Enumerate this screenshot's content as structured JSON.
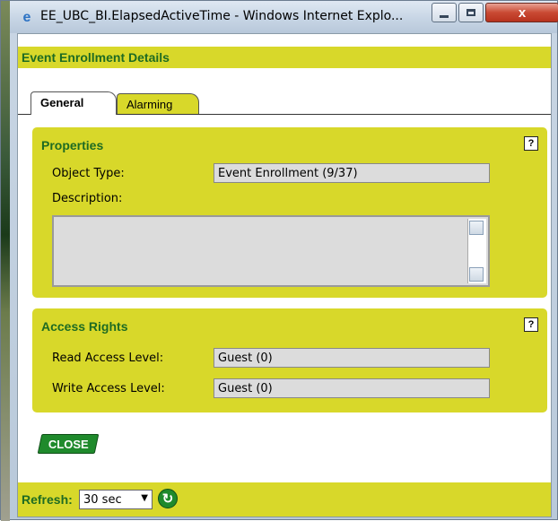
{
  "window": {
    "title": "EE_UBC_BI.ElapsedActiveTime - Windows Internet Explo...",
    "close_glyph": "x"
  },
  "header": {
    "title": "Event Enrollment Details"
  },
  "tabs": [
    {
      "label": "General",
      "active": true
    },
    {
      "label": "Alarming",
      "active": false
    }
  ],
  "properties": {
    "title": "Properties",
    "help": "?",
    "object_type_label": "Object Type:",
    "object_type_value": "Event Enrollment (9/37)",
    "description_label": "Description:",
    "description_value": ""
  },
  "access_rights": {
    "title": "Access Rights",
    "help": "?",
    "read_label": "Read Access Level:",
    "read_value": "Guest (0)",
    "write_label": "Write Access Level:",
    "write_value": "Guest (0)"
  },
  "actions": {
    "close_label": "CLOSE"
  },
  "footer": {
    "refresh_label": "Refresh:",
    "refresh_value": "30 sec"
  },
  "colors": {
    "accent_yellow": "#d8d82a",
    "accent_green": "#1e6b22",
    "button_green": "#1f8a2c"
  },
  "icons": {
    "browser": "ie-icon",
    "help": "help-icon",
    "refresh": "refresh-icon"
  }
}
